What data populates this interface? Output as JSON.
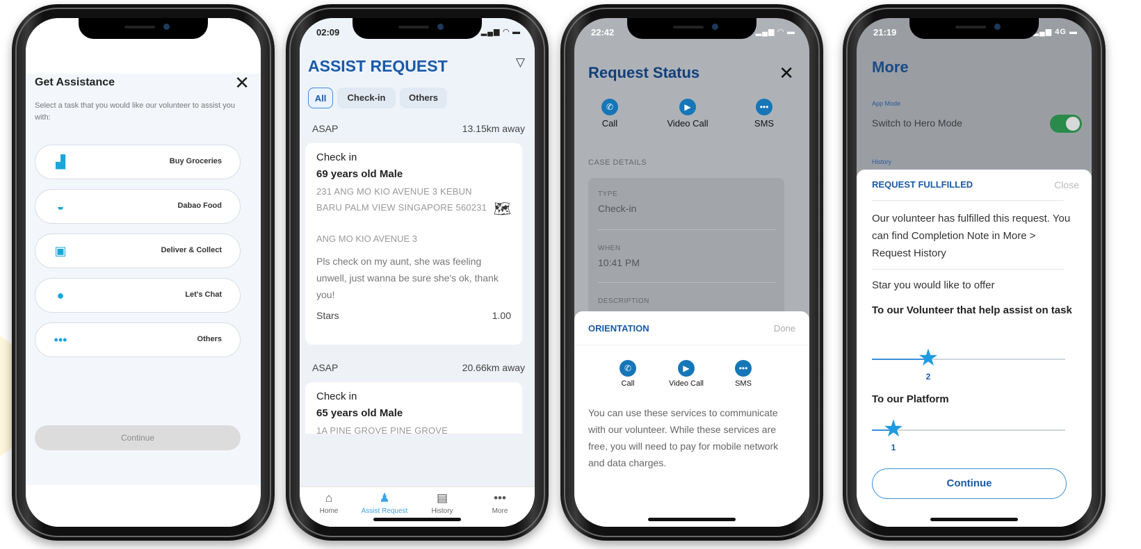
{
  "screen1": {
    "title": "Get Assistance",
    "subtitle": "Select a task that you would like our volunteer to assist you with:",
    "tasks": [
      {
        "label": "Buy Groceries",
        "icon": "grocery-bag-icon"
      },
      {
        "label": "Dabao Food",
        "icon": "food-bowl-icon"
      },
      {
        "label": "Deliver & Collect",
        "icon": "package-icon"
      },
      {
        "label": "Let's Chat",
        "icon": "chat-bubbles-icon"
      },
      {
        "label": "Others",
        "icon": "more-dots-icon"
      }
    ],
    "continue_label": "Continue"
  },
  "screen2": {
    "time": "02:09",
    "title": "ASSIST REQUEST",
    "filters": [
      "All",
      "Check-in",
      "Others"
    ],
    "requests": [
      {
        "when": "ASAP",
        "distance": "13.15km away",
        "type": "Check in",
        "person": "69 years old Male",
        "address": "231 ANG MO KIO AVENUE 3 KEBUN BARU PALM VIEW SINGAPORE 560231",
        "area": "ANG MO KIO AVENUE 3",
        "note": "Pls check on my aunt, she was feeling unwell, just wanna be sure she's ok, thank you!",
        "stars_label": "Stars",
        "stars_value": "1.00"
      },
      {
        "when": "ASAP",
        "distance": "20.66km away",
        "type": "Check in",
        "person": "65 years old Male",
        "address": "1A PINE GROVE PINE GROVE"
      }
    ],
    "tabs": [
      {
        "label": "Home",
        "icon": "home-icon"
      },
      {
        "label": "Assist Request",
        "icon": "person-icon"
      },
      {
        "label": "History",
        "icon": "archive-icon"
      },
      {
        "label": "More",
        "icon": "more-dots-icon"
      }
    ],
    "accent": "#1a5aa8"
  },
  "screen3": {
    "time": "22:42",
    "title": "Request Status",
    "actions": [
      "Call",
      "Video Call",
      "SMS"
    ],
    "case_details_label": "CASE DETAILS",
    "type_label": "TYPE",
    "type_value": "Check-in",
    "when_label": "WHEN",
    "when_value": "10:41 PM",
    "description_label": "DESCRIPTION",
    "sheet_title": "ORIENTATION",
    "sheet_done": "Done",
    "sheet_text": "You can use these services to communicate with our volunteer. While these services are free, you will need to pay for mobile network and data charges."
  },
  "screen4": {
    "time": "21:19",
    "network": "4G",
    "title": "More",
    "app_mode_label": "App Mode",
    "switch_label": "Switch to Hero Mode",
    "history_label": "History",
    "sheet_title": "REQUEST FULLFILLED",
    "sheet_close": "Close",
    "message": "Our volunteer has fulfilled this request. You can find Completion Note in More > Request History",
    "offer_label": "Star you would like to offer",
    "volunteer_heading": "To our Volunteer that help assist on task",
    "volunteer_stars": 2,
    "platform_heading": "To our Platform",
    "platform_stars": 1,
    "stars_max": 5,
    "continue_label": "Continue"
  }
}
